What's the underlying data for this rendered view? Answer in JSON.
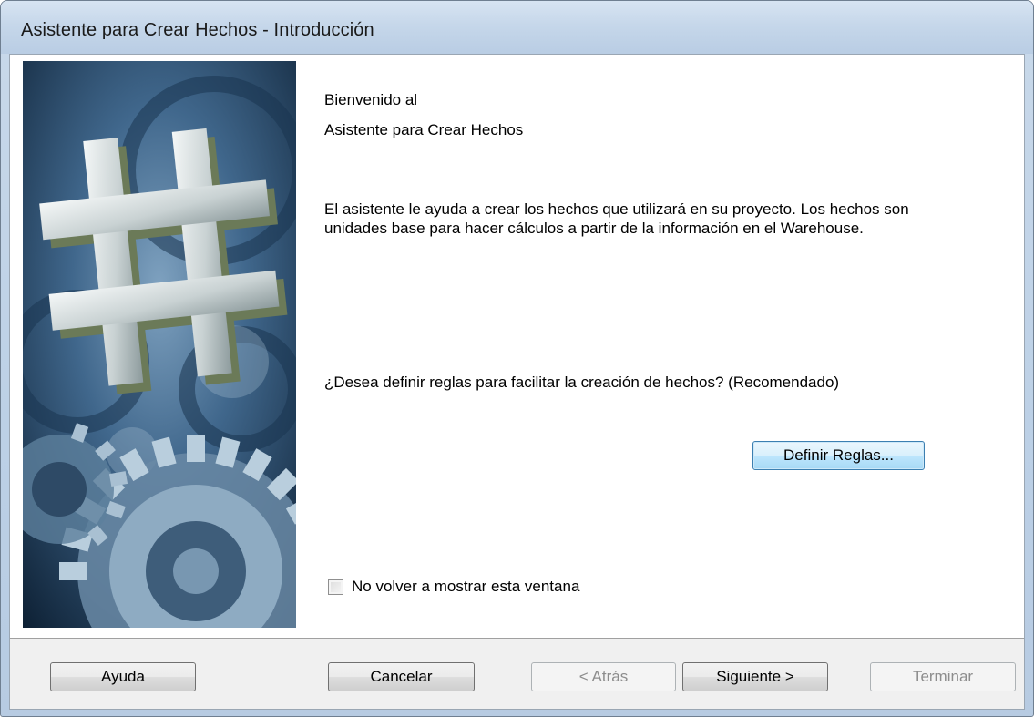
{
  "window": {
    "title": "Asistente para Crear Hechos - Introducción"
  },
  "content": {
    "welcome_line1": "Bienvenido al",
    "welcome_line2": "Asistente para Crear Hechos",
    "description_line1": "El asistente le ayuda a crear los hechos que utilizará en su proyecto. Los hechos son",
    "description_line2": "unidades base para hacer cálculos a partir de la información en el Warehouse.",
    "question": "¿Desea definir reglas para facilitar la creación de hechos? (Recomendado)",
    "define_rules_label": "Definir Reglas...",
    "checkbox_label": "No volver a mostrar esta ventana",
    "checkbox_checked": false
  },
  "footer": {
    "help_label": "Ayuda",
    "cancel_label": "Cancelar",
    "back_label": "< Atrás",
    "back_enabled": false,
    "next_label": "Siguiente >",
    "finish_label": "Terminar",
    "finish_enabled": false
  },
  "image": {
    "icon": "hash-symbol-gears-illustration"
  }
}
